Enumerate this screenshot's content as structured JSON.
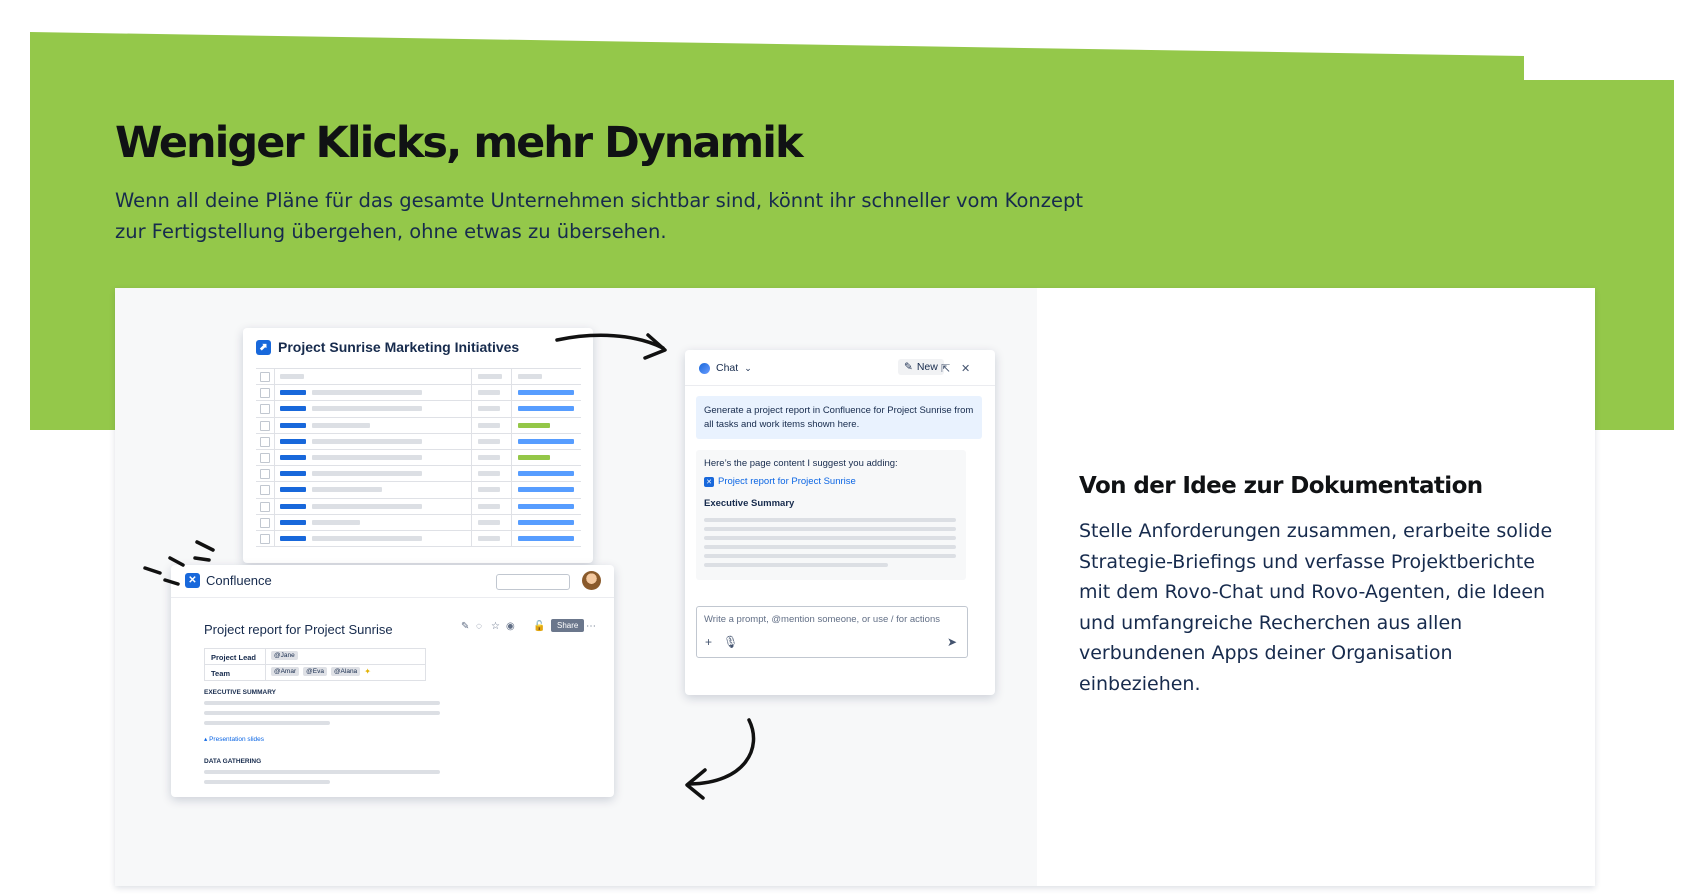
{
  "hero": {
    "title": "Weniger Klicks, mehr Dynamik",
    "subtitle": "Wenn all deine Pläne für das gesamte Unternehmen sichtbar sind, könnt ihr schneller vom Konzept zur Fertigstellung übergehen, ohne etwas zu übersehen."
  },
  "feature": {
    "title": "Von der Idee zur Dokumentation",
    "body": "Stelle Anforderungen zusammen, erarbeite solide Strategie-Briefings und verfasse Projektberichte mit dem Rovo-Chat und Rovo-Agenten, die Ideen und umfangreiche Recherchen aus allen verbundenen Apps deiner Organisation einbeziehen."
  },
  "jira": {
    "title": "Project Sunrise Marketing Initiatives",
    "rows": [
      {
        "status": "blue"
      },
      {
        "status": "blue"
      },
      {
        "status": "green"
      },
      {
        "status": "blue"
      },
      {
        "status": "green"
      },
      {
        "status": "blue"
      },
      {
        "status": "blue"
      },
      {
        "status": "blue"
      },
      {
        "status": "blue"
      },
      {
        "status": "blue"
      }
    ]
  },
  "chat": {
    "header_label": "Chat",
    "new_label": "New",
    "prompt_message": "Generate a project report in Confluence for Project Sunrise from all tasks and work items shown here.",
    "response_intro": "Here’s the page content I suggest you adding:",
    "response_link": "Project report for Project Sunrise",
    "response_heading": "Executive Summary",
    "input_placeholder": "Write a prompt, @mention someone, or use / for actions"
  },
  "confluence": {
    "app_name": "Confluence",
    "page_title": "Project report for Project Sunrise",
    "share_label": "Share",
    "props": {
      "lead_key": "Project Lead",
      "lead_value": "@Jane",
      "team_key": "Team",
      "team_values": [
        "@Amar",
        "@Eva",
        "@Alana"
      ]
    },
    "executive_summary": "EXECUTIVE SUMMARY",
    "slides_link": "Presentation slides",
    "data_gathering": "DATA GATHERING"
  },
  "colors": {
    "brand_green": "#94c84a",
    "atlassian_blue": "#1868db",
    "status_blue": "#579dff",
    "status_green": "#94c748"
  }
}
